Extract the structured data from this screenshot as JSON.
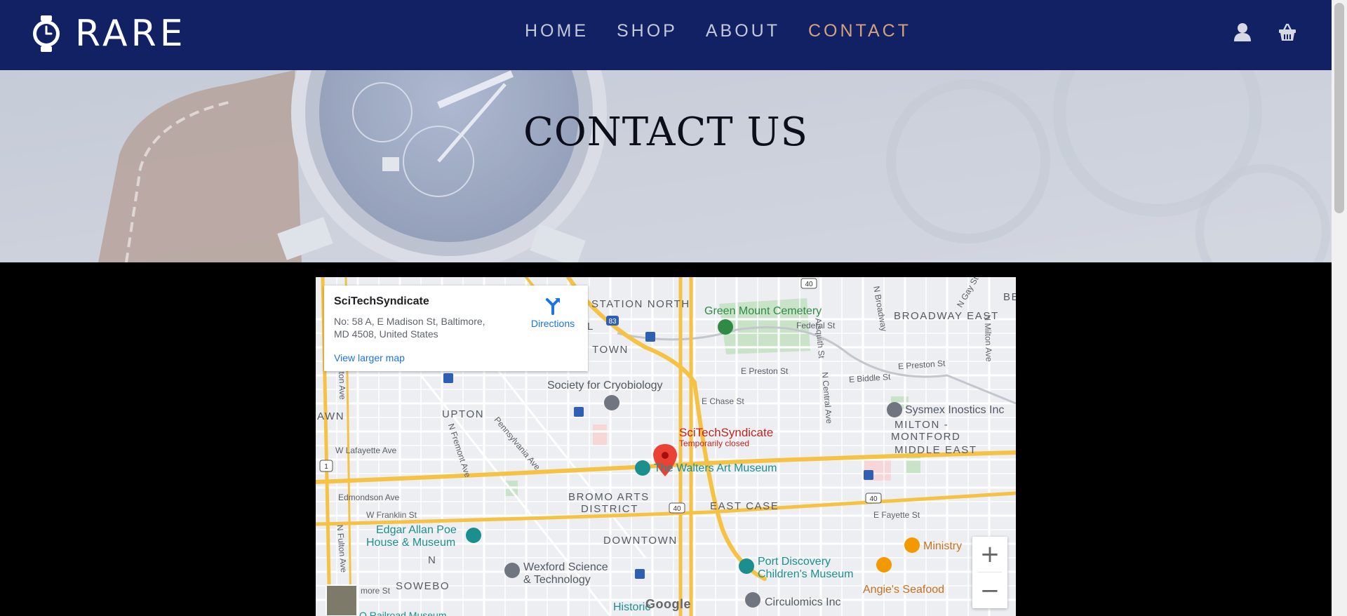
{
  "brand": {
    "name": "RARE",
    "logo_icon": "watch-icon"
  },
  "nav": {
    "items": [
      {
        "label": "HOME",
        "active": false
      },
      {
        "label": "SHOP",
        "active": false
      },
      {
        "label": "ABOUT",
        "active": false
      },
      {
        "label": "CONTACT",
        "active": true
      }
    ],
    "icons": [
      "user-icon",
      "basket-icon"
    ]
  },
  "hero": {
    "title": "CONTACT US"
  },
  "map": {
    "info_card": {
      "title": "SciTechSyndicate",
      "address": "No: 58 A, E Madison St, Baltimore, MD 4508, United States",
      "view_larger": "View larger map",
      "directions": "Directions"
    },
    "pin": {
      "name": "SciTechSyndicate",
      "status": "Temporarily closed"
    },
    "areas": [
      "STATION NORTH",
      "BROADWAY EAST",
      "UPTON",
      "MILTON -",
      "MONTFORD",
      "MIDDLE EAST",
      "BROMO ARTS",
      "DISTRICT",
      "EAST CASE",
      "DOWNTOWN",
      "SOWEBO",
      "TOWN",
      "AWN",
      "L",
      "N",
      "BE"
    ],
    "streets": [
      "N Gay St",
      "N Broadway",
      "Aisquith St",
      "Federal St",
      "N Milton Ave",
      "E Preston St",
      "E Preston St",
      "E Biddle St",
      "N Central Ave",
      "E Chase St",
      "Pennsylvania Ave",
      "N Fremont Ave",
      "W Lafayette Ave",
      "Edmondson Ave",
      "W Franklin St",
      "N Fulton Ave",
      "E Fayette St",
      "more St",
      "ilton Ave"
    ],
    "pois": {
      "cemetery": "Green Mount Cemetery",
      "cryo": "Society for Cryobiology",
      "sysmex": "Sysmex Inostics Inc",
      "walters": "The Walters Art Museum",
      "poe_1": "Edgar Allan Poe",
      "poe_2": "House & Museum",
      "wexford_1": "Wexford Science",
      "wexford_2": "& Technology",
      "port_1": "Port Discovery",
      "port_2": "Children's Museum",
      "ministry": "Ministry",
      "angies": "Angie's Seafood",
      "circulomics": "Circulomics Inc",
      "historic": "Historic",
      "railroad": "O Railroad Museum"
    },
    "shields": [
      "83",
      "40",
      "40",
      "40",
      "1"
    ],
    "zoom_in": "+",
    "zoom_out": "−",
    "google": "Google"
  }
}
